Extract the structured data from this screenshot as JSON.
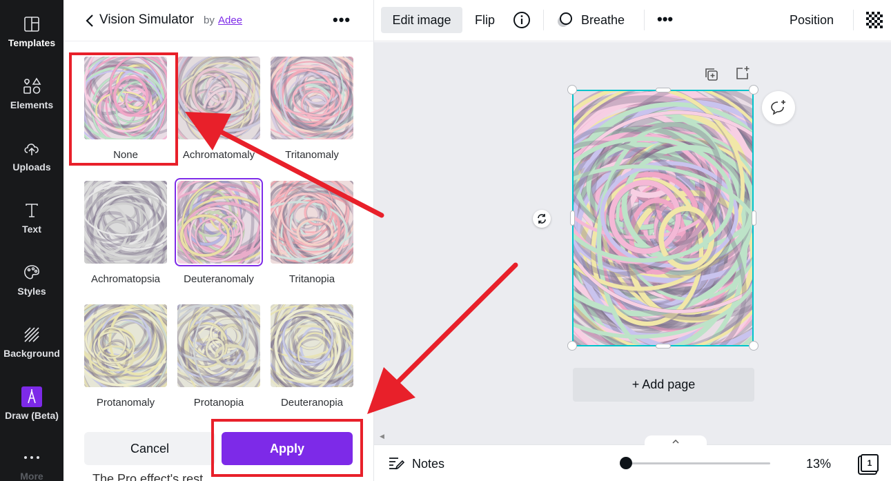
{
  "rail": {
    "items": [
      {
        "label": "Templates",
        "icon": "templates-icon"
      },
      {
        "label": "Elements",
        "icon": "elements-icon"
      },
      {
        "label": "Uploads",
        "icon": "uploads-icon"
      },
      {
        "label": "Text",
        "icon": "text-icon"
      },
      {
        "label": "Styles",
        "icon": "styles-icon"
      },
      {
        "label": "Background",
        "icon": "background-icon"
      },
      {
        "label": "Draw (Beta)",
        "icon": "draw-icon"
      },
      {
        "label": "More",
        "icon": "more-dots-icon"
      }
    ]
  },
  "panel": {
    "title": "Vision Simulator",
    "by_label": "by",
    "author": "Adee",
    "options": [
      {
        "label": "None",
        "filter": "none"
      },
      {
        "label": "Achromatomaly",
        "filter": "achromatomaly"
      },
      {
        "label": "Tritanomaly",
        "filter": "tritanomaly"
      },
      {
        "label": "Achromatopsia",
        "filter": "achromatopsia"
      },
      {
        "label": "Deuteranomaly",
        "filter": "deuteranomaly",
        "selected": true
      },
      {
        "label": "Tritanopia",
        "filter": "tritanopia"
      },
      {
        "label": "Protanomaly",
        "filter": "protanomaly"
      },
      {
        "label": "Protanopia",
        "filter": "protanopia"
      },
      {
        "label": "Deuteranopia",
        "filter": "deuteranopia"
      }
    ],
    "cancel_label": "Cancel",
    "apply_label": "Apply",
    "partial_text": "The Pro effect's rest"
  },
  "toolbar": {
    "edit_image": "Edit image",
    "flip": "Flip",
    "breathe": "Breathe",
    "position": "Position"
  },
  "canvas": {
    "add_page": "+ Add page"
  },
  "footer": {
    "notes": "Notes",
    "zoom": "13%",
    "page_count": "1"
  },
  "colors": {
    "accent": "#7d2ae8",
    "annotation": "#e8202a",
    "selection": "#00c4cc"
  }
}
